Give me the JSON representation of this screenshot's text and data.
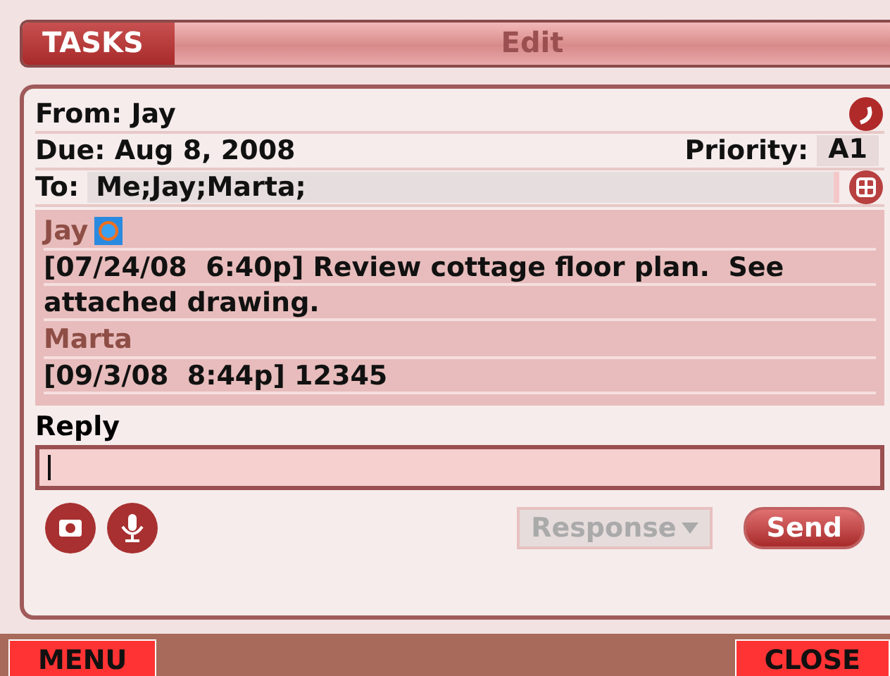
{
  "header": {
    "app": "TASKS",
    "title": "Edit"
  },
  "task": {
    "from": "From: Jay",
    "due": "Due: Aug 8, 2008",
    "priority_label": "Priority:",
    "priority": "A1",
    "to_label": "To:",
    "to": "Me;Jay;Marta;"
  },
  "messages": [
    {
      "author": "Jay",
      "has_attachment": true,
      "body": "[07/24/08  6:40p] Review cottage floor plan.  See attached drawing."
    },
    {
      "author": "Marta",
      "has_attachment": false,
      "body": "[09/3/08  8:44p] 12345"
    }
  ],
  "reply": {
    "label": "Reply"
  },
  "response": {
    "label": "Response",
    "disabled": true
  },
  "send": "Send",
  "softkeys": {
    "left": "MENU",
    "right": "CLOSE"
  }
}
